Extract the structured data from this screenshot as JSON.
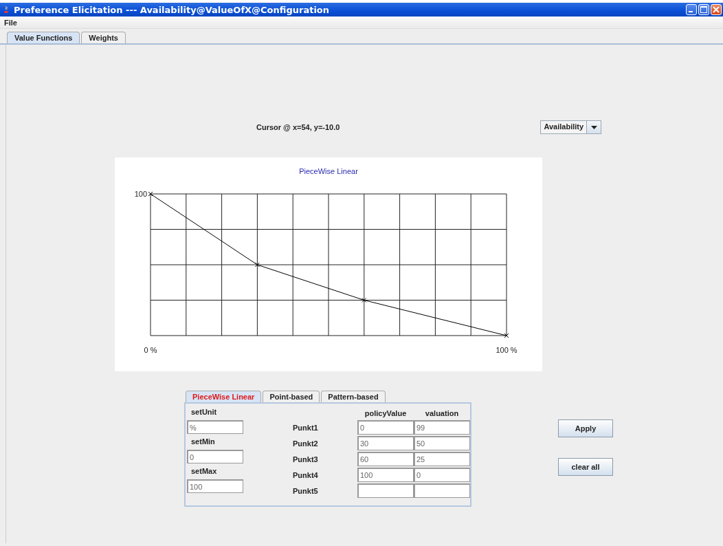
{
  "window": {
    "title": "Preference Elicitation --- Availability@ValueOfX@Configuration"
  },
  "menu": [
    "File"
  ],
  "tabs": [
    {
      "label": "Value Functions",
      "selected": true
    },
    {
      "label": "Weights",
      "selected": false
    }
  ],
  "cursor_readout": "Cursor @ x=54, y=-10.0",
  "attribute_select": {
    "value": "Availability"
  },
  "chart": {
    "title": "PieceWise Linear",
    "y_top_label": "100",
    "x_start_label": "0 %",
    "x_end_label": "100 %"
  },
  "function_tabs": [
    {
      "label": "PieceWise Linear",
      "selected": true
    },
    {
      "label": "Point-based",
      "selected": false
    },
    {
      "label": "Pattern-based",
      "selected": false
    }
  ],
  "settings": [
    {
      "label": "setUnit",
      "value": "%"
    },
    {
      "label": "setMin",
      "value": "0"
    },
    {
      "label": "setMax",
      "value": "100"
    }
  ],
  "points_header": [
    "policyValue",
    "valuation"
  ],
  "points": [
    {
      "label": "Punkt1",
      "policy_value": "0",
      "valuation": "99"
    },
    {
      "label": "Punkt2",
      "policy_value": "30",
      "valuation": "50"
    },
    {
      "label": "Punkt3",
      "policy_value": "60",
      "valuation": "25"
    },
    {
      "label": "Punkt4",
      "policy_value": "100",
      "valuation": "0"
    },
    {
      "label": "Punkt5"
    }
  ],
  "buttons": [
    "Apply",
    "clear all"
  ]
}
